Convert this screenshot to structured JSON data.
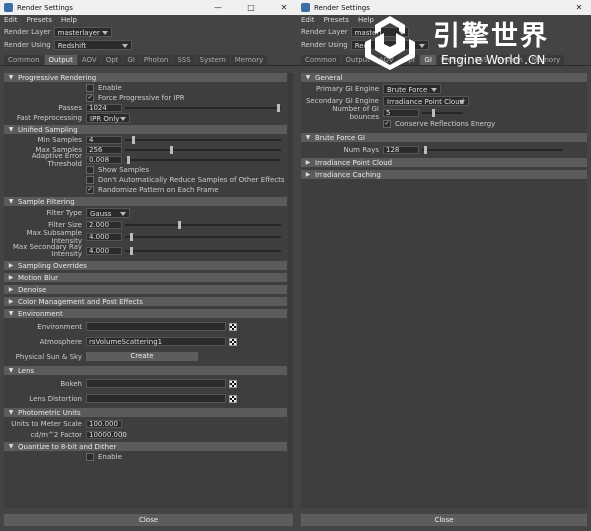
{
  "left": {
    "title": "Render Settings",
    "menu": [
      "Edit",
      "Presets",
      "Help"
    ],
    "render_layer_label": "Render Layer",
    "render_layer_value": "masterlayer",
    "render_using_label": "Render Using",
    "render_using_value": "Redshift",
    "tabs": [
      "Common",
      "Output",
      "AOV",
      "Opt",
      "GI",
      "Photon",
      "SSS",
      "System",
      "Memory"
    ],
    "active_tab": "Output",
    "sections": {
      "progressive": {
        "title": "Progressive Rendering",
        "enable": "Enable",
        "force_ipr": "Force Progressive for IPR",
        "passes_label": "Passes",
        "passes_value": "1024",
        "passes_pos": 1.0,
        "fast_label": "Fast Preprocessing",
        "fast_value": "IPR Only"
      },
      "unified": {
        "title": "Unified Sampling",
        "min_label": "Min Samples",
        "min_value": "4",
        "min_pos": 0.05,
        "max_label": "Max Samples",
        "max_value": "256",
        "max_pos": 0.3,
        "aet_label": "Adaptive Error Threshold",
        "aet_value": "0.008",
        "aet_pos": 0.02,
        "show_samples": "Show Samples",
        "dont_reduce": "Don't Automatically Reduce Samples of Other Effects",
        "randomize": "Randomize Pattern on Each Frame"
      },
      "filtering": {
        "title": "Sample Filtering",
        "type_label": "Filter Type",
        "type_value": "Gauss",
        "size_label": "Filter Size",
        "size_value": "2.000",
        "size_pos": 0.35,
        "max_sub_label": "Max Subsample Intensity",
        "max_sub_value": "4.000",
        "max_sub_pos": 0.04,
        "max_sec_label1": "Max Secondary Ray",
        "max_sec_label2": "Intensity",
        "max_sec_value": "4.000",
        "max_sec_pos": 0.04
      },
      "collapsed": [
        "Sampling Overrides",
        "Motion Blur",
        "Denoise",
        "Color Management and Post Effects"
      ],
      "environment": {
        "title": "Environment",
        "env_label": "Environment",
        "atm_label": "Atmosphere",
        "atm_value": "rsVolumeScattering1",
        "sun_label": "Physical Sun & Sky",
        "create": "Create"
      },
      "lens": {
        "title": "Lens",
        "bokeh": "Bokeh",
        "distortion": "Lens Distortion"
      },
      "photometric": {
        "title": "Photometric Units",
        "scale_label": "Units to Meter Scale",
        "scale_value": "100.000",
        "factor_label": "cd/m^2 Factor",
        "factor_value": "10000.000"
      },
      "quantize": {
        "title": "Quantize to 8-bit and Dither",
        "enable": "Enable"
      }
    },
    "close": "Close"
  },
  "right": {
    "title": "Render Settings",
    "menu": [
      "Edit",
      "Presets",
      "Help"
    ],
    "render_layer_label": "Render Layer",
    "render_layer_value": "masterl",
    "render_using_label": "Render Using",
    "render_using_value": "Red",
    "tabs": [
      "Common",
      "Output",
      "AOV",
      "Opt",
      "GI",
      "Photon",
      "SSS",
      "System",
      "Memory"
    ],
    "active_tab": "GI",
    "general": {
      "title": "General",
      "primary_label": "Primary GI Engine",
      "primary_value": "Brute Force",
      "secondary_label": "Secondary GI Engine",
      "secondary_value": "Irradiance Point Cloud",
      "bounces_label": "Number of GI bounces",
      "bounces_value": "5",
      "bounces_pos": 0.3,
      "conserve": "Conserve Reflections Energy"
    },
    "brute": {
      "title": "Brute Force GI",
      "rays_label": "Num Rays",
      "rays_value": "128",
      "rays_pos": 0.02
    },
    "collapsed": [
      "Irradiance Point Cloud",
      "Irradiance Caching"
    ],
    "close": "Close"
  },
  "watermark": {
    "cn": "引擎世界",
    "en": "Engine World .CN"
  },
  "colors": {
    "panel": "#444444",
    "section_header": "#5b5b5b",
    "field": "#2b2b2b",
    "watermark": "#ffffff"
  }
}
